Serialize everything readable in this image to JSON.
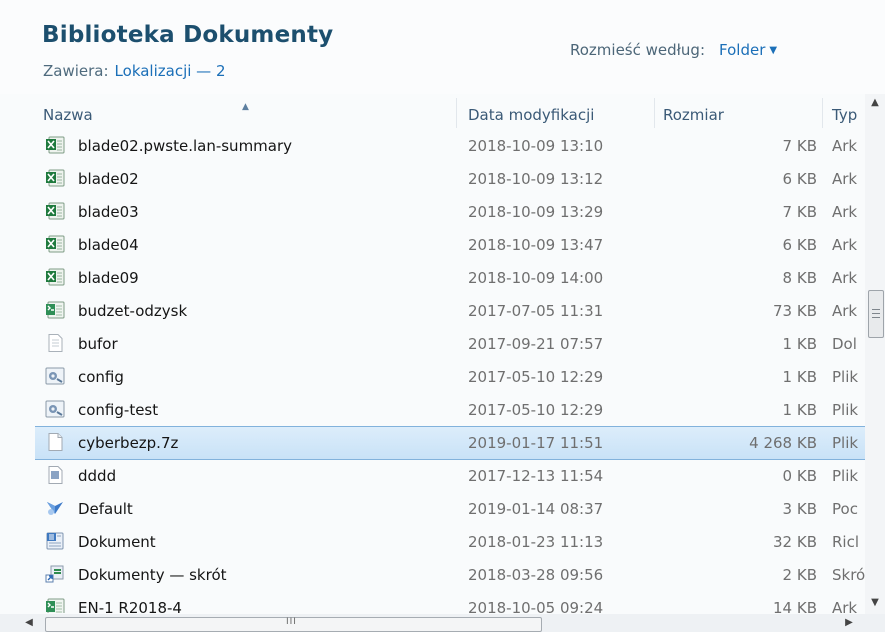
{
  "header": {
    "title": "Biblioteka Dokumenty",
    "includes_label": "Zawiera:",
    "includes_link": "Lokalizacji — 2",
    "arrange_label": "Rozmieść według:",
    "arrange_value": "Folder"
  },
  "columns": {
    "name": "Nazwa",
    "date": "Data modyfikacji",
    "size": "Rozmiar",
    "type": "Typ"
  },
  "files": [
    {
      "name": "blade02.pwste.lan-summary",
      "date": "2018-10-09 13:10",
      "size": "7 KB",
      "type": "Ark",
      "icon": "excel-icon"
    },
    {
      "name": "blade02",
      "date": "2018-10-09 13:12",
      "size": "6 KB",
      "type": "Ark",
      "icon": "excel-icon"
    },
    {
      "name": "blade03",
      "date": "2018-10-09 13:29",
      "size": "7 KB",
      "type": "Ark",
      "icon": "excel-icon"
    },
    {
      "name": "blade04",
      "date": "2018-10-09 13:47",
      "size": "6 KB",
      "type": "Ark",
      "icon": "excel-icon"
    },
    {
      "name": "blade09",
      "date": "2018-10-09 14:00",
      "size": "8 KB",
      "type": "Ark",
      "icon": "excel-icon"
    },
    {
      "name": "budzet-odzysk",
      "date": "2017-07-05 11:31",
      "size": "73 KB",
      "type": "Ark",
      "icon": "spreadsheet-icon"
    },
    {
      "name": "bufor",
      "date": "2017-09-21 07:57",
      "size": "1 KB",
      "type": "Dol",
      "icon": "text-file-icon"
    },
    {
      "name": "config",
      "date": "2017-05-10 12:29",
      "size": "1 KB",
      "type": "Plik",
      "icon": "config-file-icon"
    },
    {
      "name": "config-test",
      "date": "2017-05-10 12:29",
      "size": "1 KB",
      "type": "Plik",
      "icon": "config-file-icon"
    },
    {
      "name": "cyberbezp.7z",
      "date": "2019-01-17 11:51",
      "size": "4 268 KB",
      "type": "Plik",
      "icon": "blank-file-icon",
      "selected": true
    },
    {
      "name": "dddd",
      "date": "2017-12-13 11:54",
      "size": "0 KB",
      "type": "Plik",
      "icon": "doc-file-icon"
    },
    {
      "name": "Default",
      "date": "2019-01-14 08:37",
      "size": "3 KB",
      "type": "Poc",
      "icon": "remote-desktop-icon"
    },
    {
      "name": "Dokument",
      "date": "2018-01-23 11:13",
      "size": "32 KB",
      "type": "Ricl",
      "icon": "rich-text-icon"
    },
    {
      "name": "Dokumenty — skrót",
      "date": "2018-03-28 09:56",
      "size": "2 KB",
      "type": "Skró",
      "icon": "shortcut-icon"
    },
    {
      "name": "EN-1 R2018-4",
      "date": "2018-10-05 09:24",
      "size": "14 KB",
      "type": "Ark",
      "icon": "spreadsheet-icon"
    }
  ],
  "colors": {
    "title": "#1c4f6e",
    "link": "#1b6fb8",
    "selection": "#c9e2f7",
    "excel_green": "#1f7a3e"
  }
}
